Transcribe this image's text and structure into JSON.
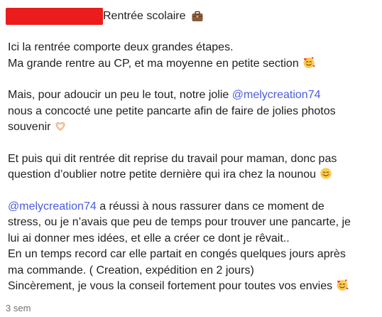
{
  "post": {
    "title": "Rentrée scolaire",
    "title_icon": "briefcase-icon",
    "paragraphs": [
      {
        "lines": [
          {
            "text": "Ici la rentrée comporte deux grandes étapes."
          },
          {
            "text": "Ma grande rentre au CP, et ma moyenne en petite section",
            "emoji": "smiling-face-with-hearts-icon"
          }
        ]
      },
      {
        "lines": [
          {
            "before": "Mais, pour adoucir un peu le tout, notre jolie ",
            "mention": "@melycreation74"
          },
          {
            "text": "nous a concocté une petite pancarte afin de faire de jolies photos"
          },
          {
            "text": "souvenir",
            "emoji": "heart-hands-icon"
          }
        ]
      },
      {
        "lines": [
          {
            "text": "Et puis qui dit rentrée dit reprise du travail pour maman, donc pas"
          },
          {
            "text": "question d’oublier notre petite dernière qui ira chez la nounou",
            "emoji": "smiling-face-with-smiling-eyes-icon"
          }
        ]
      },
      {
        "lines": [
          {
            "mention": "@melycreation74",
            "after": " a réussi à nous rassurer dans ce moment de"
          },
          {
            "text": "stress, ou je n’avais que peu de temps pour trouver une pancarte, je"
          },
          {
            "text": "lui ai donner mes idées, et elle a créer ce dont je rêvait.."
          },
          {
            "text": "En un temps record car elle partait en congés quelques jours après"
          },
          {
            "text": "ma commande. ( Creation, expédition en 2 jours)"
          },
          {
            "text": "Sincèrement, je vous la conseil fortement pour toutes vos envies",
            "emoji": "smiling-face-with-hearts-icon"
          }
        ]
      }
    ],
    "timestamp": "3 sem"
  }
}
